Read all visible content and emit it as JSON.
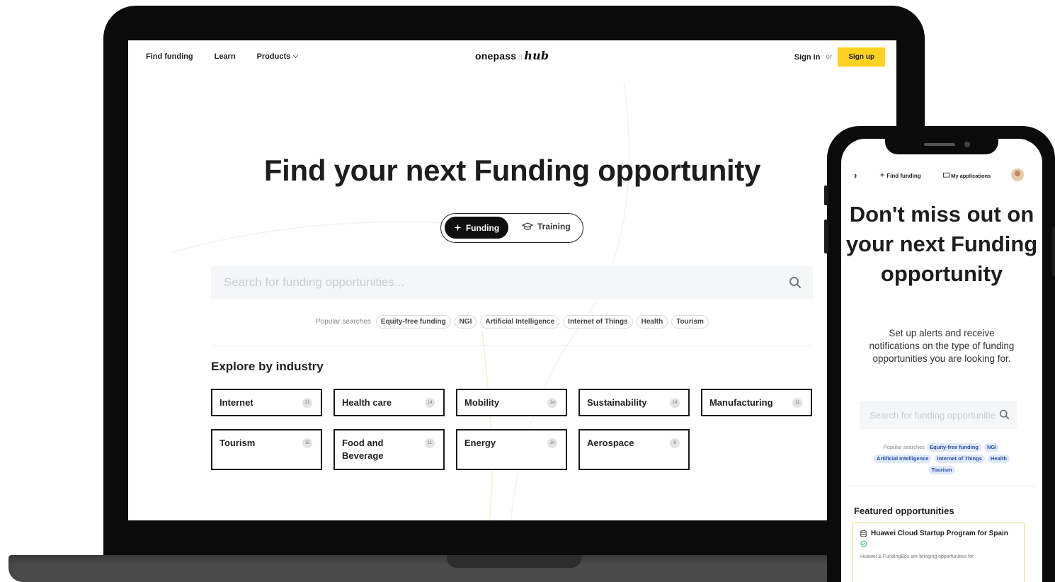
{
  "laptop": {
    "nav": {
      "find_funding": "Find funding",
      "learn": "Learn",
      "products": "Products",
      "logo_brand": "onepass",
      "logo_sep": "::",
      "logo_script": "hub",
      "sign_in": "Sign in",
      "or": "or",
      "sign_up": "Sign up"
    },
    "hero_title": "Find your next Funding opportunity",
    "toggle": {
      "funding": "Funding",
      "training": "Training"
    },
    "search": {
      "placeholder": "Search for funding opportunities..."
    },
    "popular": {
      "label": "Popular searches",
      "chips": [
        "Equity-free funding",
        "NGI",
        "Artificial Intelligence",
        "Internet of Things",
        "Health",
        "Tourism"
      ]
    },
    "explore_title": "Explore by industry",
    "industries": [
      {
        "label": "Internet",
        "count": "21"
      },
      {
        "label": "Health care",
        "count": "14"
      },
      {
        "label": "Mobility",
        "count": "14"
      },
      {
        "label": "Sustainability",
        "count": "14"
      },
      {
        "label": "Manufacturing",
        "count": "11"
      },
      {
        "label": "Tourism",
        "count": "15"
      },
      {
        "label": "Food and Beverage",
        "count": "11"
      },
      {
        "label": "Energy",
        "count": "10"
      },
      {
        "label": "Aerospace",
        "count": "8"
      }
    ]
  },
  "phone": {
    "nav": {
      "brand": "›",
      "find_funding": "Find funding",
      "my_applications": "My applications"
    },
    "title": "Don't miss out on your next Funding opportunity",
    "description": "Set up alerts and receive notifications on the type of funding opportunities you are looking for.",
    "search": {
      "placeholder": "Search for funding opportunities..."
    },
    "popular": {
      "label": "Popular searches",
      "chips": [
        "Equity-free funding",
        "NGI",
        "Artificial Intelligence",
        "Internet of Things",
        "Health",
        "Tourism"
      ]
    },
    "featured_title": "Featured opportunities",
    "card": {
      "title": "Huawei Cloud Startup Program for Spain",
      "desc": "Huawei & FundingBox are bringing opportunities for"
    }
  },
  "colors": {
    "accent_yellow": "#ffd21f",
    "dark": "#0f0f0f",
    "chip_blue_bg": "#dfe9fb",
    "chip_blue_text": "#2a4ea6"
  }
}
